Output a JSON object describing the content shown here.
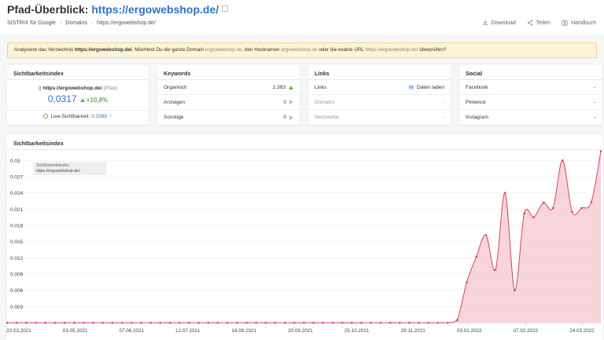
{
  "header": {
    "title_prefix": "Pfad-Überblick: ",
    "title_link": "https://ergowebshop.de/",
    "breadcrumbs": [
      "SISTRIX für Google",
      "Domains",
      "https://ergowebshop.de/"
    ],
    "actions": {
      "download": "Download",
      "share": "Teilen",
      "manual": "Handbuch"
    }
  },
  "notice": {
    "part1": "Analysiere das Verzeichnis ",
    "dir": "https://ergowebshop.de/",
    "part2": ". Möchtest Du die ganze Domain ",
    "domain": "ergowebshop.de",
    "part3": ", den Hostnamen ",
    "hostname": "ergowebshop.de",
    "part4": " oder die exakte URL ",
    "url": "https://ergowebshop.de/",
    "part5": " überprüfen?"
  },
  "visibility": {
    "title": "Sichtbarkeitsindex",
    "domain": "https://ergowebshop.de/",
    "domain_note": "(Pfad)",
    "value": "0,0317",
    "change": "+10,8%",
    "live_label": "Live-Sichtbarkeit: ",
    "live_value": "0,0289",
    "live_help": "?"
  },
  "keywords": {
    "title": "Keywords",
    "rows": [
      {
        "label": "Organisch",
        "value": "2.393"
      },
      {
        "label": "Anzeigen",
        "value": "0"
      },
      {
        "label": "Sonstige",
        "value": "0"
      }
    ]
  },
  "links": {
    "title": "Links",
    "rows": [
      {
        "label": "Links",
        "value": "Daten laden"
      },
      {
        "label": "Domains",
        "value": "-"
      },
      {
        "label": "Netzwerke",
        "value": "-"
      }
    ]
  },
  "social": {
    "title": "Social",
    "rows": [
      {
        "label": "Facebook",
        "value": "-"
      },
      {
        "label": "Pinterest",
        "value": "-"
      },
      {
        "label": "Instagram",
        "value": "-"
      }
    ]
  },
  "tooltip": {
    "line1": "Sichtbarkeitsindex",
    "line2": "https://ergowebshop.de/"
  },
  "colors": {
    "accent": "#2f72c4",
    "line": "#d04a5e",
    "fill": "#f5c6cf",
    "positive": "#6ab04c"
  },
  "chart_data": {
    "type": "area",
    "title": "Sichtbarkeitsindex",
    "xlabel": "",
    "ylabel": "",
    "ylim": [
      0,
      0.0315
    ],
    "yticks": [
      "0.03",
      "0.027",
      "0.024",
      "0.021",
      "0.018",
      "0.015",
      "0.012",
      "0.009",
      "0.006",
      "0.003"
    ],
    "ytick_values": [
      0.03,
      0.027,
      0.024,
      0.021,
      0.018,
      0.015,
      0.012,
      0.009,
      0.006,
      0.003
    ],
    "xticks": [
      "22.03.2021",
      "03.05.2021",
      "07.06.2021",
      "12.07.2021",
      "16.08.2021",
      "20.09.2021",
      "25.10.2021",
      "29.11.2021",
      "03.01.2022",
      "07.02.2022",
      "24.03.2022"
    ],
    "series": [
      {
        "values": [
          0,
          0,
          0,
          0,
          0,
          0,
          0,
          0,
          0,
          0,
          0,
          0,
          0,
          0,
          0,
          0,
          0,
          0,
          0,
          0,
          0,
          0,
          0,
          0,
          0,
          0,
          0,
          0,
          0,
          0,
          0,
          0,
          0,
          0,
          0,
          0,
          0,
          0,
          0,
          0,
          0,
          0,
          0,
          0,
          0,
          0,
          0,
          0.0005,
          0.0075,
          0.0122,
          0.0162,
          0.0098,
          0.024,
          0.006,
          0.0202,
          0.0195,
          0.0222,
          0.0212,
          0.03,
          0.0205,
          0.0212,
          0.0223,
          0.0317
        ]
      }
    ]
  }
}
